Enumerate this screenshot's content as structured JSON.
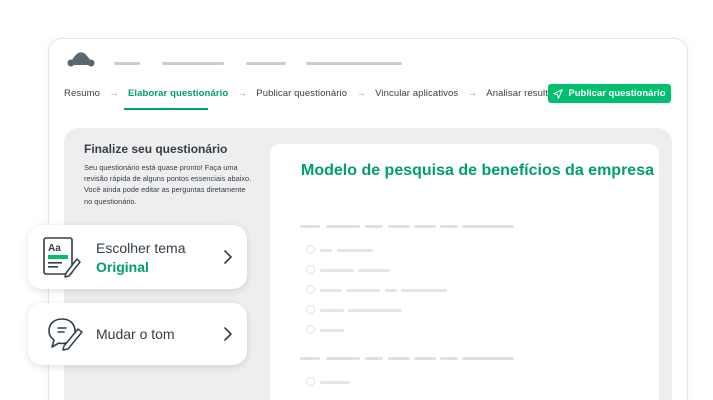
{
  "nav": {
    "steps": [
      {
        "label": "Resumo",
        "active": false
      },
      {
        "label": "Elaborar questionário",
        "active": true
      },
      {
        "label": "Publicar questionário",
        "active": false
      },
      {
        "label": "Vincular aplicativos",
        "active": false
      },
      {
        "label": "Analisar resultados",
        "active": false
      }
    ],
    "arrow": "→",
    "publish_button": "Publicar questionário"
  },
  "sidebar": {
    "title": "Finalize seu questionário",
    "description": "Seu questionário está quase pronto! Faça uma revisão rápida de alguns pontos essenciais abaixo. Você ainda pode editar as perguntas diretamente no questionário."
  },
  "cards": {
    "theme": {
      "label": "Escolher tema",
      "value": "Original"
    },
    "tone": {
      "label": "Mudar o tom"
    }
  },
  "survey": {
    "title": "Modelo de pesquisa de benefícios da empresa"
  },
  "colors": {
    "brand": "#00bf6f",
    "accent_text": "#00a067",
    "panel_bg": "#eeeeee",
    "text": "#333e48"
  },
  "icons": [
    "monkey-logo-icon",
    "send-icon",
    "aa-theme-icon",
    "chat-edit-icon",
    "chevron-right-icon"
  ]
}
